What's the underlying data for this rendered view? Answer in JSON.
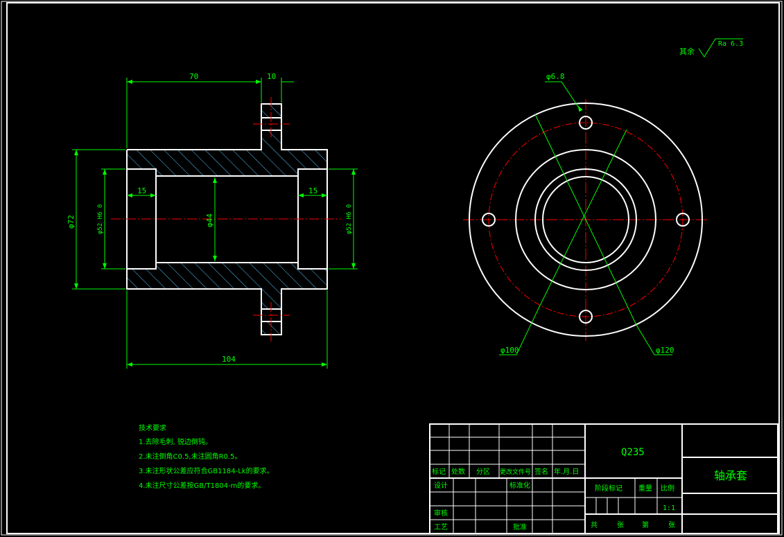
{
  "roughness": {
    "label": "其余",
    "value": "Ra 6.3"
  },
  "front_view": {
    "dims": {
      "d70": "70",
      "d10": "10",
      "d104": "104",
      "d72": "φ72",
      "d52_left": "φ52 H6 0",
      "d52_right": "φ52 H6 0",
      "d44": "φ44",
      "d15_left": "15",
      "d15_right": "15"
    }
  },
  "side_view": {
    "dims": {
      "hole": "φ6.8",
      "d100": "φ100",
      "d120": "φ120"
    }
  },
  "tech_requirements": {
    "title": "技术要求",
    "items": [
      "1.去除毛刺, 锐边倒钝。",
      "2.未注倒角C0.5,未注圆角R0.5。",
      "3.未注形状公差应符合GB1184-Lk的要求。",
      "4.未注尺寸公差按GB/T1804-m的要求。"
    ]
  },
  "title_block": {
    "material": "Q235",
    "part_name": "轴承套",
    "rev_headers": [
      "标记",
      "处数",
      "分区",
      "更改文件号",
      "签名",
      "年.月.日"
    ],
    "sign_rows": [
      "设计",
      "审核",
      "工艺"
    ],
    "standardization": "标准化",
    "approval": "批准",
    "stage_mark": "阶段标记",
    "weight": "重量",
    "scale": "比例",
    "scale_value": "1:1",
    "sheet_total": "共",
    "sheet_unit_1": "张",
    "sheet_no": "第",
    "sheet_unit_2": "张"
  },
  "colors": {
    "background": "#000000",
    "outline": "#ffffff",
    "dimension": "#00ff00",
    "centerline": "#ff0000",
    "hatch": "#55c8ff",
    "text_title": "#00ff00"
  }
}
